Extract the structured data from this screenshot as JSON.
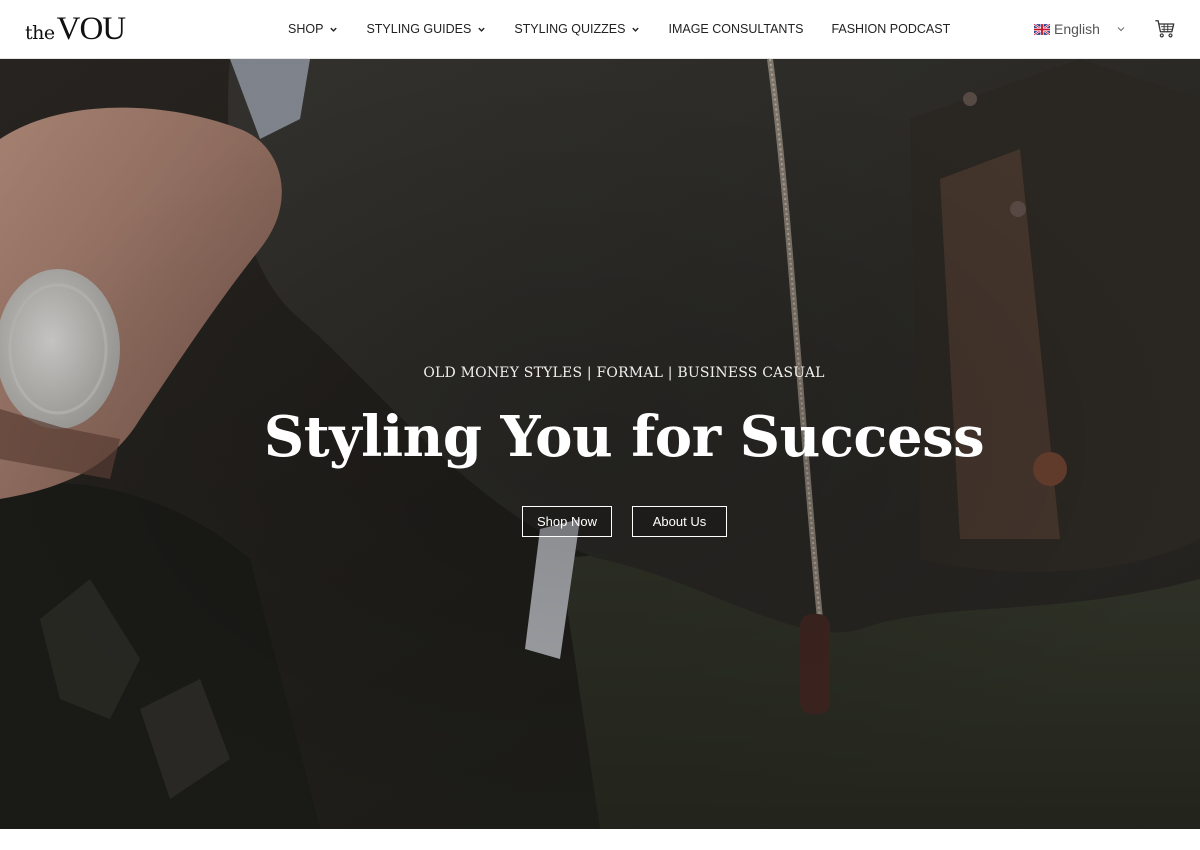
{
  "header": {
    "logo": {
      "small": "the",
      "large": "VOU"
    },
    "nav": [
      {
        "label": "SHOP",
        "has_dropdown": true
      },
      {
        "label": "STYLING GUIDES",
        "has_dropdown": true
      },
      {
        "label": "STYLING QUIZZES",
        "has_dropdown": true
      },
      {
        "label": "IMAGE CONSULTANTS",
        "has_dropdown": false
      },
      {
        "label": "FASHION PODCAST",
        "has_dropdown": false
      }
    ],
    "language": {
      "label": "English",
      "icon": "uk-flag-icon"
    },
    "cart_icon": "cart-icon"
  },
  "hero": {
    "kicker": "OLD MONEY STYLES | FORMAL | BUSINESS CASUAL",
    "headline": "Styling You for Success",
    "buttons": {
      "shop": "Shop Now",
      "about": "About Us"
    }
  },
  "colors": {
    "accent": "#ffffff",
    "header_bg": "#ffffff",
    "hero_dark": "#262420"
  }
}
